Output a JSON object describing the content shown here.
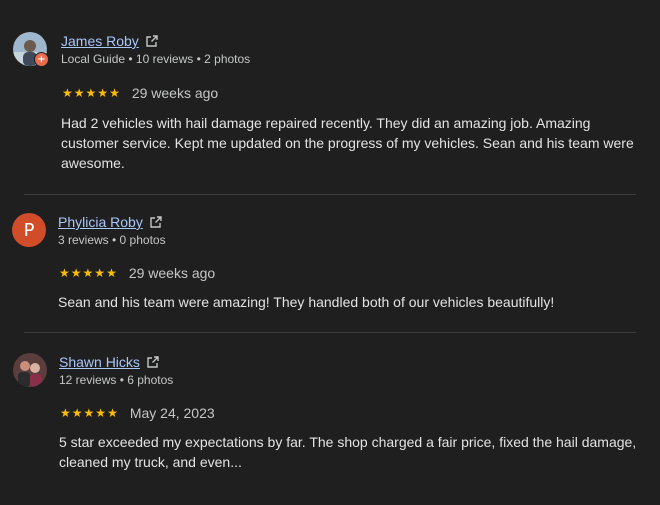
{
  "reviews": [
    {
      "name": "James Roby",
      "meta": "Local Guide • 10 reviews • 2 photos",
      "rating": 5,
      "date": "29 weeks ago",
      "text": "Had 2 vehicles with hail damage repaired recently. They did an amazing job. Amazing customer service. Kept me updated on the progress of my vehicles. Sean and his team were awesome."
    },
    {
      "name": "Phylicia Roby",
      "avatar_letter": "P",
      "avatar_color": "#d14d2a",
      "meta": "3 reviews • 0 photos",
      "rating": 5,
      "date": "29 weeks ago",
      "text": "Sean and his team were amazing! They handled both of our vehicles beautifully!"
    },
    {
      "name": "Shawn Hicks",
      "meta": "12 reviews • 6 photos",
      "rating": 5,
      "date": "May 24, 2023",
      "text": "5 star exceeded my expectations by far. The shop charged a fair price, fixed the hail damage, cleaned my truck, and even..."
    }
  ],
  "icons": {
    "external_link": "external-link-icon",
    "star": "star-icon",
    "guide_badge": "local-guide-badge-icon"
  },
  "colors": {
    "background": "#1f1f1f",
    "link": "#a8c7fa",
    "star": "#fbbc04"
  }
}
